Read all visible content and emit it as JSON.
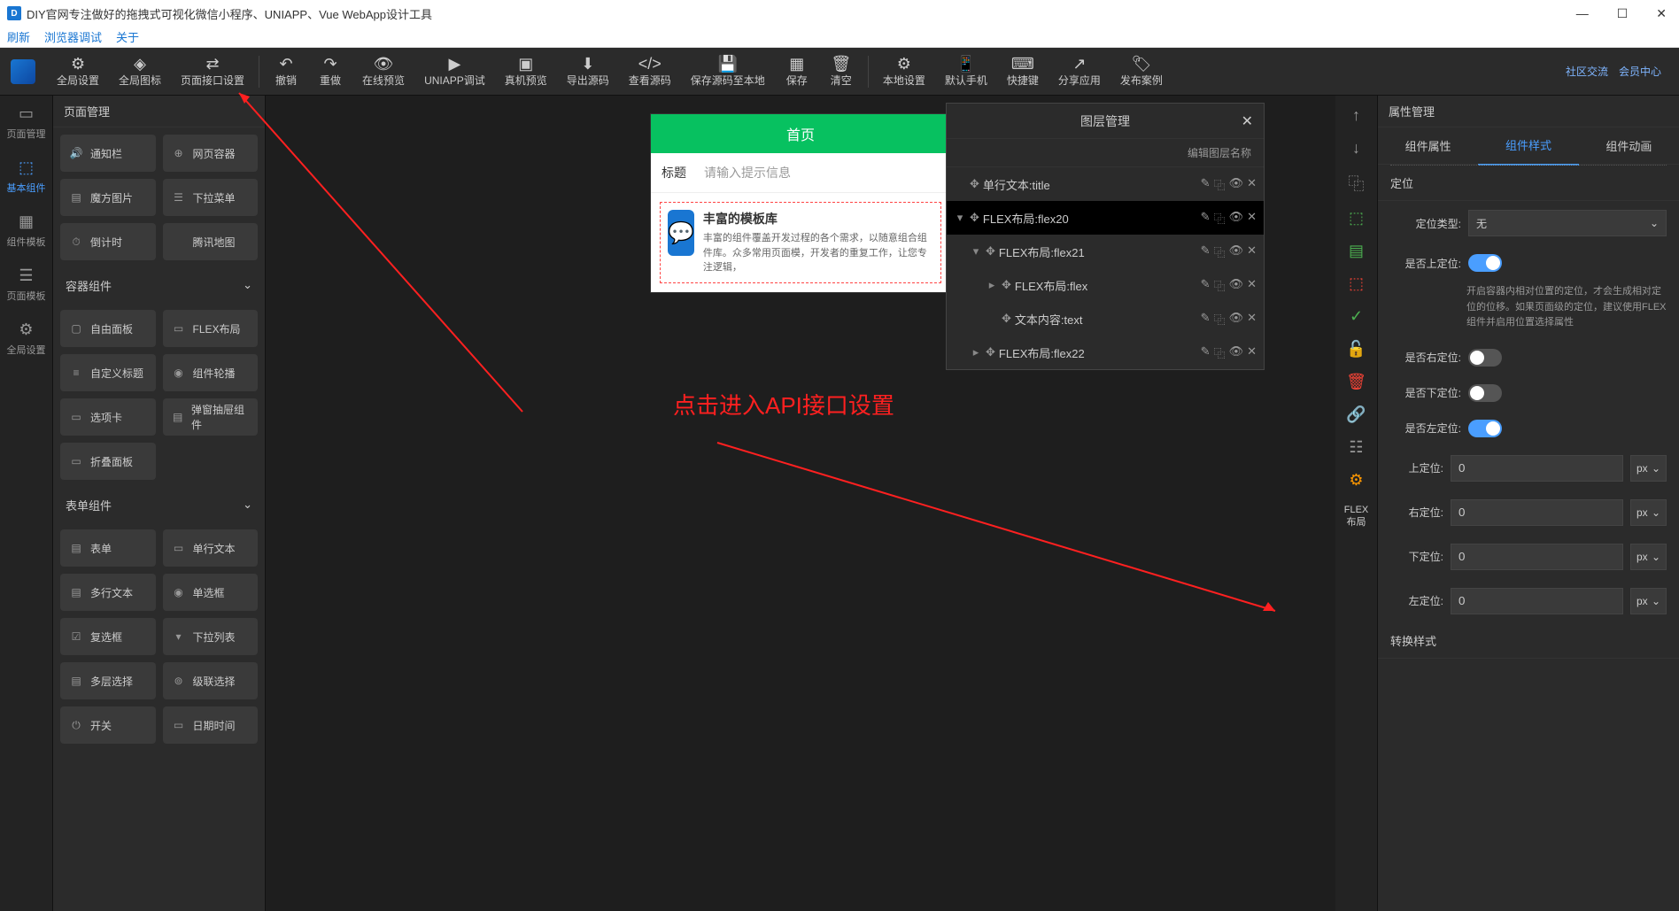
{
  "titlebar": {
    "title": "DIY官网专注做好的拖拽式可视化微信小程序、UNIAPP、Vue WebApp设计工具"
  },
  "menubar": {
    "items": [
      "刷新",
      "浏览器调试",
      "关于"
    ]
  },
  "toolbar": {
    "items": [
      {
        "label": "全局设置",
        "icon": "⚙"
      },
      {
        "label": "全局图标",
        "icon": "◈"
      },
      {
        "label": "页面接口设置",
        "icon": "⇄"
      }
    ],
    "items2": [
      {
        "label": "撤销",
        "icon": "↶"
      },
      {
        "label": "重做",
        "icon": "↷"
      },
      {
        "label": "在线预览",
        "icon": "👁"
      },
      {
        "label": "UNIAPP调试",
        "icon": "▶"
      },
      {
        "label": "真机预览",
        "icon": "▣"
      },
      {
        "label": "导出源码",
        "icon": "⬇"
      },
      {
        "label": "查看源码",
        "icon": "</>"
      },
      {
        "label": "保存源码至本地",
        "icon": "💾"
      },
      {
        "label": "保存",
        "icon": "▦"
      },
      {
        "label": "清空",
        "icon": "🗑"
      }
    ],
    "items3": [
      {
        "label": "本地设置",
        "icon": "⚙"
      },
      {
        "label": "默认手机",
        "icon": "📱"
      },
      {
        "label": "快捷键",
        "icon": "⌨"
      },
      {
        "label": "分享应用",
        "icon": "↗"
      },
      {
        "label": "发布案例",
        "icon": "🏷"
      }
    ],
    "right": [
      "社区交流",
      "会员中心"
    ]
  },
  "rail": [
    {
      "label": "页面管理",
      "icon": "▭"
    },
    {
      "label": "基本组件",
      "icon": "⬚",
      "active": true
    },
    {
      "label": "组件模板",
      "icon": "▦"
    },
    {
      "label": "页面模板",
      "icon": "☰"
    },
    {
      "label": "全局设置",
      "icon": "⚙"
    }
  ],
  "comps": {
    "header": "页面管理",
    "row1": [
      {
        "label": "通知栏",
        "icon": "🔊"
      },
      {
        "label": "网页容器",
        "icon": "⊕"
      }
    ],
    "row2": [
      {
        "label": "魔方图片",
        "icon": "▤"
      },
      {
        "label": "下拉菜单",
        "icon": "☰"
      }
    ],
    "row3": [
      {
        "label": "倒计时",
        "icon": "⏱"
      },
      {
        "label": "腾讯地图",
        "icon": ""
      }
    ],
    "group1": "容器组件",
    "row4": [
      {
        "label": "自由面板",
        "icon": "▢"
      },
      {
        "label": "FLEX布局",
        "icon": "▭"
      }
    ],
    "row5": [
      {
        "label": "自定义标题",
        "icon": "≡"
      },
      {
        "label": "组件轮播",
        "icon": "◉"
      }
    ],
    "row6": [
      {
        "label": "选项卡",
        "icon": "▭"
      },
      {
        "label": "弹窗抽屉组件",
        "icon": "▤"
      }
    ],
    "row7": [
      {
        "label": "折叠面板",
        "icon": "▭"
      }
    ],
    "group2": "表单组件",
    "row8": [
      {
        "label": "表单",
        "icon": "▤"
      },
      {
        "label": "单行文本",
        "icon": "▭"
      }
    ],
    "row9": [
      {
        "label": "多行文本",
        "icon": "▤"
      },
      {
        "label": "单选框",
        "icon": "◉"
      }
    ],
    "row10": [
      {
        "label": "复选框",
        "icon": "☑"
      },
      {
        "label": "下拉列表",
        "icon": "▾"
      }
    ],
    "row11": [
      {
        "label": "多层选择",
        "icon": "▤"
      },
      {
        "label": "级联选择",
        "icon": "⊚"
      }
    ],
    "row12": [
      {
        "label": "开关",
        "icon": "⏻"
      },
      {
        "label": "日期时间",
        "icon": "▭"
      }
    ]
  },
  "phone": {
    "title": "首页",
    "rowLabel": "标题",
    "rowPlaceholder": "请输入提示信息",
    "cardTitle": "丰富的模板库",
    "cardDesc": "丰富的组件覆盖开发过程的各个需求，以随意组合组件库。众多常用页面模，开发者的重复工作，让您专注逻辑，"
  },
  "annotation": "点击进入API接口设置",
  "layers": {
    "title": "图层管理",
    "sub": "编辑图层名称",
    "rows": [
      {
        "label": "单行文本:title",
        "indent": 0,
        "caret": "",
        "selected": false
      },
      {
        "label": "FLEX布局:flex20",
        "indent": 0,
        "caret": "▾",
        "selected": true
      },
      {
        "label": "FLEX布局:flex21",
        "indent": 1,
        "caret": "▾",
        "selected": false
      },
      {
        "label": "FLEX布局:flex",
        "indent": 2,
        "caret": "▸",
        "selected": false
      },
      {
        "label": "文本内容:text",
        "indent": 2,
        "caret": "",
        "selected": false
      },
      {
        "label": "FLEX布局:flex22",
        "indent": 1,
        "caret": "▸",
        "selected": false
      }
    ]
  },
  "rightRail": {
    "flexLabel": "FLEX\n布局"
  },
  "props": {
    "header": "属性管理",
    "tabs": [
      "组件属性",
      "组件样式",
      "组件动画"
    ],
    "activeTab": 1,
    "posGroup": "定位",
    "posType": {
      "label": "定位类型:",
      "value": "无"
    },
    "topEnable": {
      "label": "是否上定位:",
      "on": true
    },
    "help": "开启容器内相对位置的定位，才会生成相对定位的位移。如果页面级的定位，建议使用FLEX组件并启用位置选择属性",
    "rightEnable": {
      "label": "是否右定位:",
      "on": false
    },
    "bottomEnable": {
      "label": "是否下定位:",
      "on": false
    },
    "leftEnable": {
      "label": "是否左定位:",
      "on": true
    },
    "topVal": {
      "label": "上定位:",
      "value": "0",
      "unit": "px"
    },
    "rightVal": {
      "label": "右定位:",
      "value": "0",
      "unit": "px"
    },
    "bottomVal": {
      "label": "下定位:",
      "value": "0",
      "unit": "px"
    },
    "leftVal": {
      "label": "左定位:",
      "value": "0",
      "unit": "px"
    },
    "transformGroup": "转换样式"
  }
}
